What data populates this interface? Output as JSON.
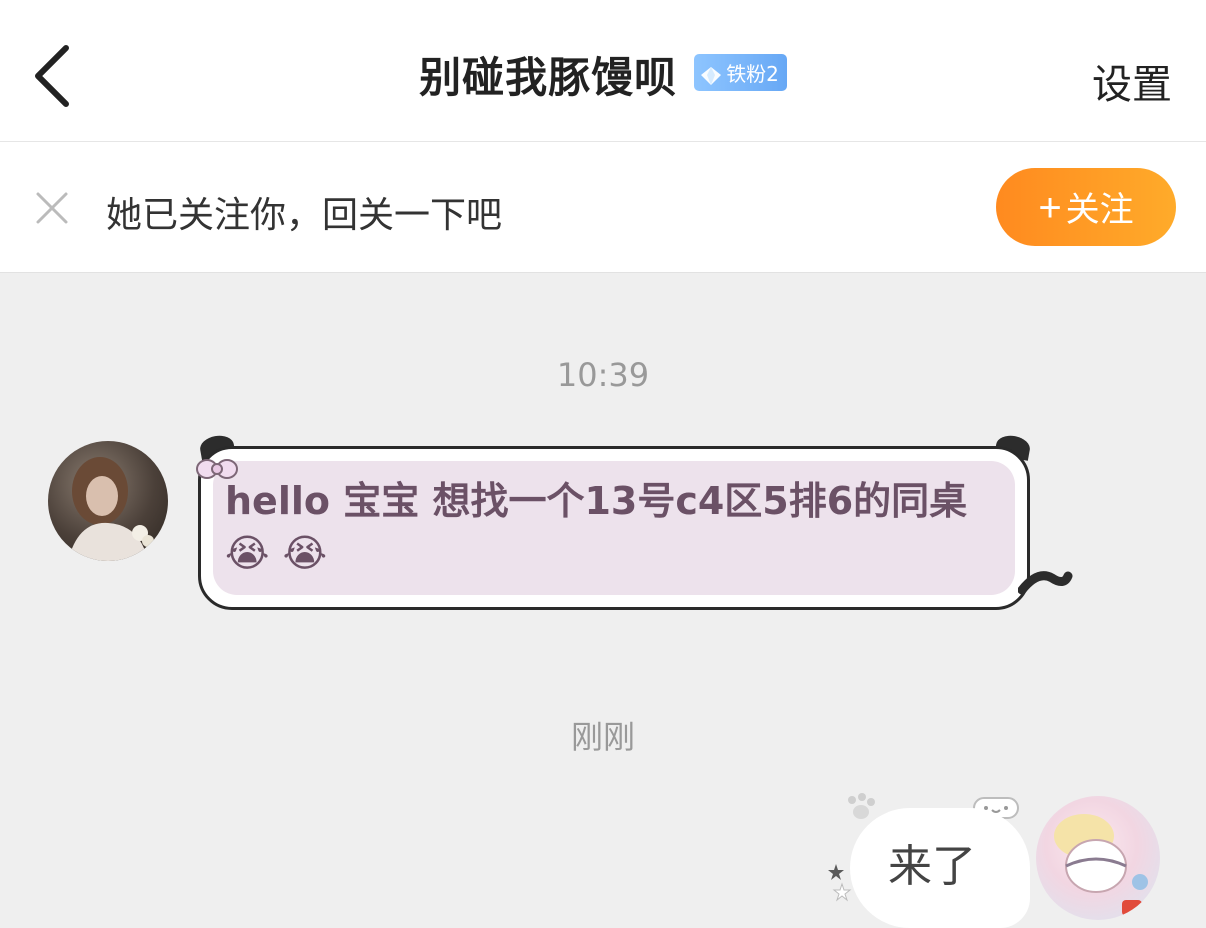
{
  "header": {
    "title": "别碰我豚馒呗",
    "badge_label": "铁粉2",
    "settings_label": "设置"
  },
  "follow_prompt": {
    "message": "她已关注你，回关一下吧",
    "button_label": "关注"
  },
  "messages": [
    {
      "time": "10:39",
      "direction": "incoming",
      "text": "hello 宝宝 想找一个13号c4区5排6的同桌😭 😭"
    },
    {
      "time": "刚刚",
      "direction": "outgoing",
      "text": "来了"
    }
  ],
  "colors": {
    "accent_orange": "#ff9a22",
    "badge_blue": "#7ab7fa",
    "incoming_bubble_fill": "#ede2ec",
    "incoming_text": "#6b5166"
  }
}
